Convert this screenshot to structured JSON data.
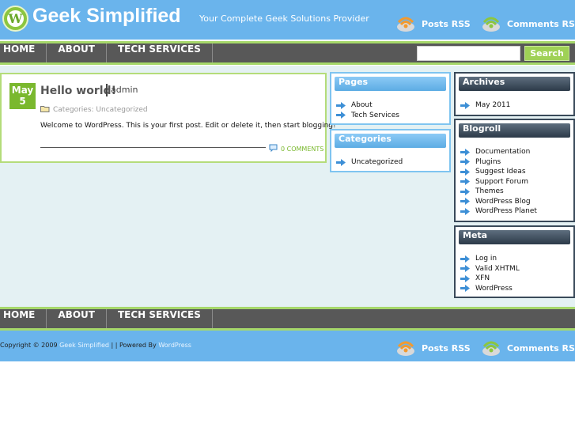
{
  "header": {
    "site_title": "Geek Simplified",
    "tagline": "Your Complete Geek Solutions Provider",
    "posts_rss": "Posts RSS",
    "comments_rss": "Comments RSS",
    "logo_letter": "W"
  },
  "nav": {
    "items": [
      "HOME",
      "ABOUT",
      "TECH SERVICES"
    ],
    "search_button": "Search",
    "search_value": ""
  },
  "post": {
    "month": "May",
    "day": "5",
    "title": "Hello world!",
    "author": "admin",
    "categories": "Categories: Uncategorized",
    "body": "Welcome to WordPress. This is your first post. Edit or delete it, then start blogging!",
    "comments": "0 COMMENTS"
  },
  "pages": {
    "title": "Pages",
    "items": [
      "About",
      "Tech Services"
    ]
  },
  "categories": {
    "title": "Categories",
    "items": [
      "Uncategorized"
    ]
  },
  "archives": {
    "title": "Archives",
    "items": [
      "May 2011"
    ]
  },
  "blogroll": {
    "title": "Blogroll",
    "items": [
      "Documentation",
      "Plugins",
      "Suggest Ideas",
      "Support Forum",
      "Themes",
      "WordPress Blog",
      "WordPress Planet"
    ]
  },
  "meta": {
    "title": "Meta",
    "items": [
      "Log in",
      "Valid XHTML",
      "XFN",
      "WordPress"
    ]
  },
  "footer": {
    "nav_items": [
      "HOME",
      "ABOUT",
      "TECH SERVICES"
    ],
    "copyright_prefix": "Copyright © 2009",
    "site_link": "Geek Simplified",
    "powered_prefix": "| | Powered By",
    "powered_link": "WordPress",
    "posts_rss": "Posts RSS",
    "comments_rss": "Comments RSS"
  },
  "colors": {
    "header_blue": "#6ab4ec",
    "accent_green": "#8cc63f",
    "nav_gray": "#585858",
    "rss_orange": "#f39a2e",
    "rss_green": "#8cc63f"
  }
}
